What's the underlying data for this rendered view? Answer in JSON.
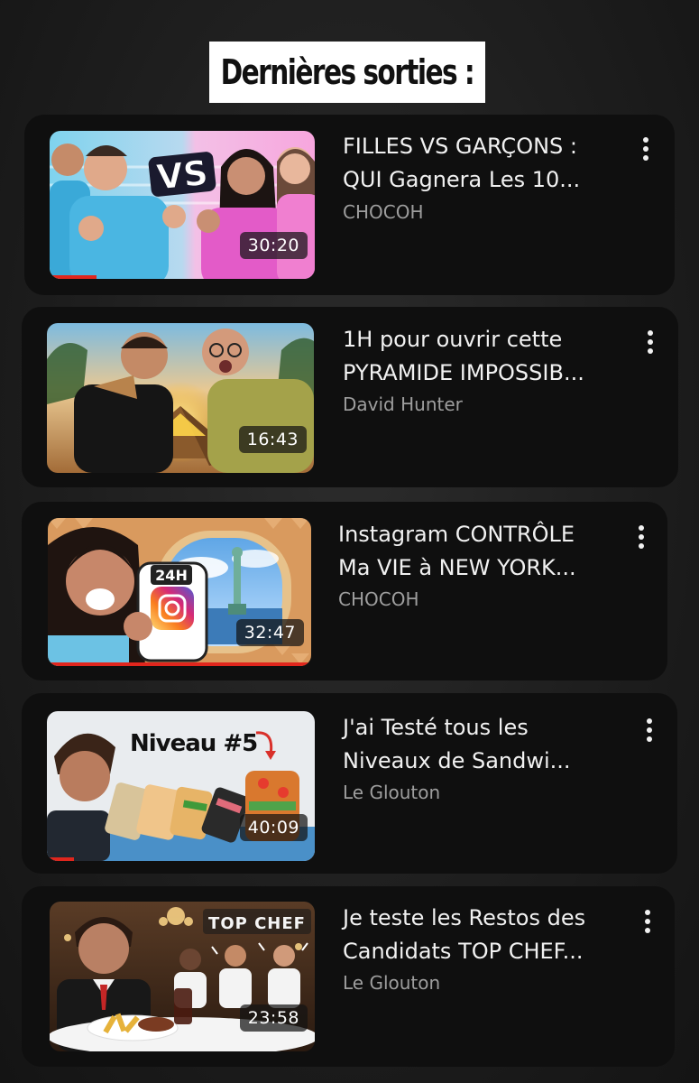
{
  "header": {
    "title": "Dernières sorties :"
  },
  "videos": [
    {
      "title": "FILLES VS GARÇONS :\nQUI Gagnera Les 10...",
      "channel": "CHOCOH",
      "duration": "30:20",
      "thumb_text": "VS"
    },
    {
      "title": "1H pour ouvrir cette\nPYRAMIDE IMPOSSIB...",
      "channel": "David Hunter",
      "duration": "16:43"
    },
    {
      "title": "Instagram CONTRÔLE\nMa VIE à NEW YORK...",
      "channel": "CHOCOH",
      "duration": "32:47",
      "thumb_text": "24H"
    },
    {
      "title": "J'ai Testé tous les\nNiveaux de Sandwi...",
      "channel": "Le Glouton",
      "duration": "40:09",
      "thumb_text": "Niveau #5"
    },
    {
      "title": "Je teste les Restos des\nCandidats TOP CHEF...",
      "channel": "Le Glouton",
      "duration": "23:58",
      "thumb_text": "TOP CHEF"
    }
  ],
  "icons": {
    "menu": "more-vertical-icon"
  },
  "colors": {
    "progress": "#e0261d",
    "card": "#0f0f0f",
    "channel_text": "#9e9e9e"
  }
}
